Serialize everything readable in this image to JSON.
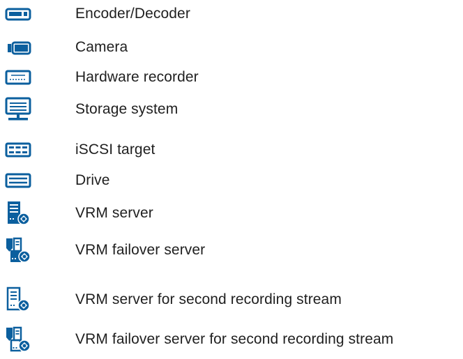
{
  "legend": {
    "items": [
      {
        "icon": "encoder-decoder-icon",
        "label": "Encoder/Decoder"
      },
      {
        "icon": "camera-icon",
        "label": "Camera"
      },
      {
        "icon": "hardware-recorder-icon",
        "label": "Hardware recorder"
      },
      {
        "icon": "storage-system-icon",
        "label": "Storage system"
      },
      {
        "icon": "iscsi-target-icon",
        "label": "iSCSI target"
      },
      {
        "icon": "drive-icon",
        "label": "Drive"
      },
      {
        "icon": "vrm-server-icon",
        "label": "VRM server"
      },
      {
        "icon": "vrm-failover-server-icon",
        "label": "VRM failover server"
      },
      {
        "icon": "vrm-second-stream-server-icon",
        "label": "VRM server for second recording stream"
      },
      {
        "icon": "vrm-failover-second-stream-server-icon",
        "label": "VRM failover server for second recording stream"
      }
    ]
  },
  "colors": {
    "icon_blue": "#0b5f9e",
    "icon_light_blue": "#1f7fc4",
    "text": "#1f1f1f",
    "background": "#ffffff"
  }
}
